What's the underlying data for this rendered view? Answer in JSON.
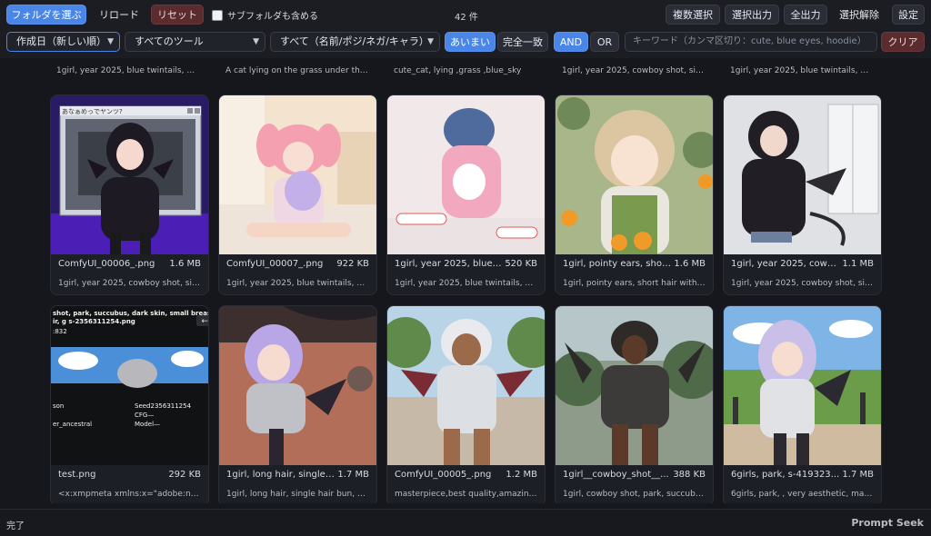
{
  "toolbar": {
    "select_folder": "フォルダを選ぶ",
    "reload": "リロード",
    "reset": "リセット",
    "include_subfolders": "サブフォルダも含める",
    "count": "42 件",
    "multi_select": "複数選択",
    "export_selected": "選択出力",
    "export_all": "全出力",
    "clear_selection": "選択解除",
    "settings": "設定"
  },
  "filters": {
    "sort": "作成日（新しい順）",
    "tool": "すべてのツール",
    "scope": "すべて（名前/ポジ/ネガ/キャラ）",
    "fuzzy": "あいまい",
    "exact": "完全一致",
    "and": "AND",
    "or": "OR",
    "keyword_placeholder": "キーワード（カンマ区切り：cute, blue eyes, hoodie）",
    "clear": "クリア"
  },
  "top_partial_prompts": [
    "1girl, year 2025, blue twintails, pink ...",
    "A cat lying on the grass under the bl...",
    "cute_cat, lying ,grass ,blue_sky",
    "1girl, year 2025, cowboy shot, simpl...",
    "1girl, year 2025, blue twintails, pink ..."
  ],
  "cards_row1": [
    {
      "name": "ComfyUI_00006_.png",
      "size": "1.6 MB",
      "prompt": "1girl, year 2025, cowboy shot, simpl..."
    },
    {
      "name": "ComfyUI_00007_.png",
      "size": "922 KB",
      "prompt": "1girl, year 2025, blue twintails, pink ..."
    },
    {
      "name": "1girl, year 2025, blue t...",
      "size": "520 KB",
      "prompt": "1girl, year 2025, blue twintails, pink ..."
    },
    {
      "name": "1girl, pointy ears, short...",
      "size": "1.6 MB",
      "prompt": "1girl, pointy ears, short hair with lon..."
    },
    {
      "name": "1girl, year 2025, cowbo...",
      "size": "1.1 MB",
      "prompt": "1girl, year 2025, cowboy shot, simpl..."
    }
  ],
  "cards_row2": [
    {
      "name": "test.png",
      "size": "292 KB",
      "prompt": "<x:xmpmeta xmlns:x=\"adobe:ns:met..."
    },
    {
      "name": "1girl, long hair, single h...",
      "size": "1.7 MB",
      "prompt": "1girl, long hair, single hair bun, side ..."
    },
    {
      "name": "ComfyUI_00005_.png",
      "size": "1.2 MB",
      "prompt": "masterpiece,best quality,amazing qu..."
    },
    {
      "name": "1girl__cowboy_shot__...",
      "size": "388 KB",
      "prompt": "1girl, cowboy shot, park, succubus, ..."
    },
    {
      "name": "6girls, park, s-419323...",
      "size": "1.7 MB",
      "prompt": "6girls, park, , very aesthetic, master..."
    }
  ],
  "window_title": "あなぁめっでヤンツ?",
  "test_overlay": {
    "line1": "shot, park, succubus, dark skin, small breasts,",
    "line2": "ir, g s-2356311254.png",
    "line3": ":832",
    "left1": "son",
    "left2": "er_ancestral",
    "seed": "Seed2356311254",
    "cfg": "CFG—",
    "model": "Model—"
  },
  "status": "完了",
  "brand": "Prompt Seek"
}
